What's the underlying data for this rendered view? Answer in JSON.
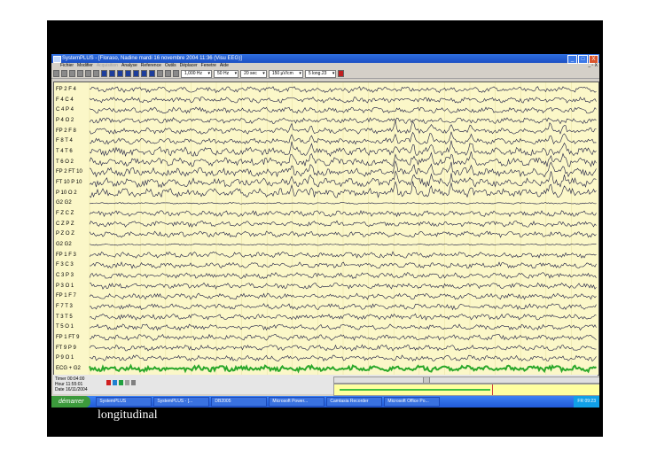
{
  "window": {
    "title": "SystemPLUS - [Floraso, Nadine mardi 16 novembre 2004 11:36 (Visu EEG)]",
    "buttons": [
      "_",
      "□",
      "X"
    ]
  },
  "menu": {
    "items": [
      "Fichier",
      "Modifier",
      "Acquisition",
      "Analyse",
      "Reference",
      "Outils",
      "Déplacer",
      "Fenetre",
      "Aide"
    ],
    "right": "_ ▫ X"
  },
  "toolbar": {
    "selects": [
      "1,000 Hz",
      "50 Hz",
      "20 sec",
      "150 µV/cm",
      "5 long.23"
    ]
  },
  "channels": [
    "FP 2 F 4",
    "F 4 C 4",
    "C 4 P 4",
    "P 4 O 2",
    "FP 2 F 8",
    "F 8 T 4",
    "T 4 T 6",
    "T 6 O 2",
    "FP 2 FT 10",
    "FT 10 P 10",
    "P 10 O 2",
    "G2 G2",
    "F Z C Z",
    "C Z P Z",
    "P Z O Z",
    "G2 G2",
    "FP 1 F 3",
    "F 3 C 3",
    "C 3 P 3",
    "P 3 O 1",
    "FP 1 F 7",
    "F 7 T 3",
    "T 3 T 5",
    "T 5 O 1",
    "FP 1 FT 9",
    "FT 9 P 9",
    "P 9 O 1",
    "ECG + G2"
  ],
  "info": {
    "timer": "Timer  00:04:00",
    "hour": "Hour   11:55:01",
    "date": "Date   16/11/2004"
  },
  "taskbar": {
    "start": "démarrer",
    "tasks": [
      "SystemPLUS",
      "SystemPLUS - [...",
      "DB2005",
      "Microsoft Power...",
      "Camtasia Recorder",
      "Microsoft Office Po..."
    ],
    "tray": "FR  09:23"
  },
  "caption": "longitudinal",
  "colors": {
    "plot_bg": "#fbf7c8",
    "trace": "#1a1a40",
    "title_bar": "#1b4fc4",
    "taskbar": "#2159d6"
  }
}
